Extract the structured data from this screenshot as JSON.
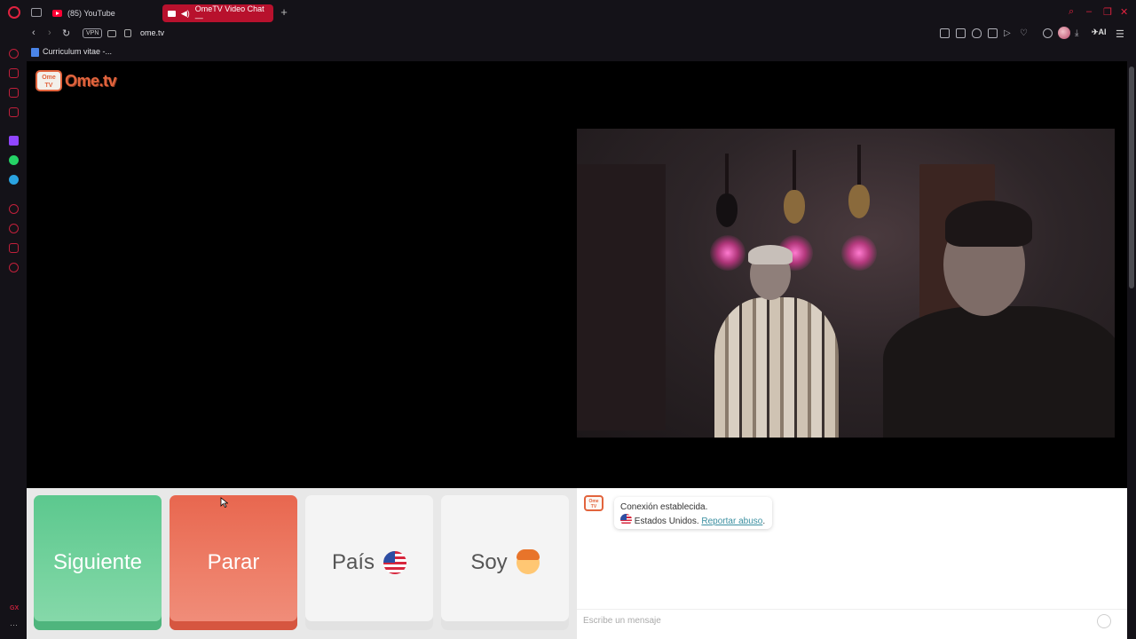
{
  "browser": {
    "tabs": [
      {
        "label": "(85) YouTube",
        "active": false
      },
      {
        "label": "OmeTV Video Chat — ",
        "active": true
      }
    ],
    "url": "ome.tv",
    "vpn_label": "VPN",
    "ai_label": "AI",
    "bookmark": "Curriculum vitae -...",
    "sidebar_gx": "GX"
  },
  "site": {
    "logo_badge": "Ome TV",
    "logo_text": "Ome.tv"
  },
  "controls": {
    "next_label": "Siguiente",
    "stop_label": "Parar",
    "country_label": "País",
    "gender_label": "Soy"
  },
  "chat": {
    "logo_badge": "Ome TV",
    "status_line": "Conexión establecida.",
    "country_line": "Estados Unidos.",
    "report_link": "Reportar abuso",
    "input_placeholder": "Escribe un mensaje"
  },
  "colors": {
    "accent": "#e0223f",
    "next_button": "#5cc88e",
    "stop_button": "#e8674f",
    "brand": "#e2643d"
  }
}
